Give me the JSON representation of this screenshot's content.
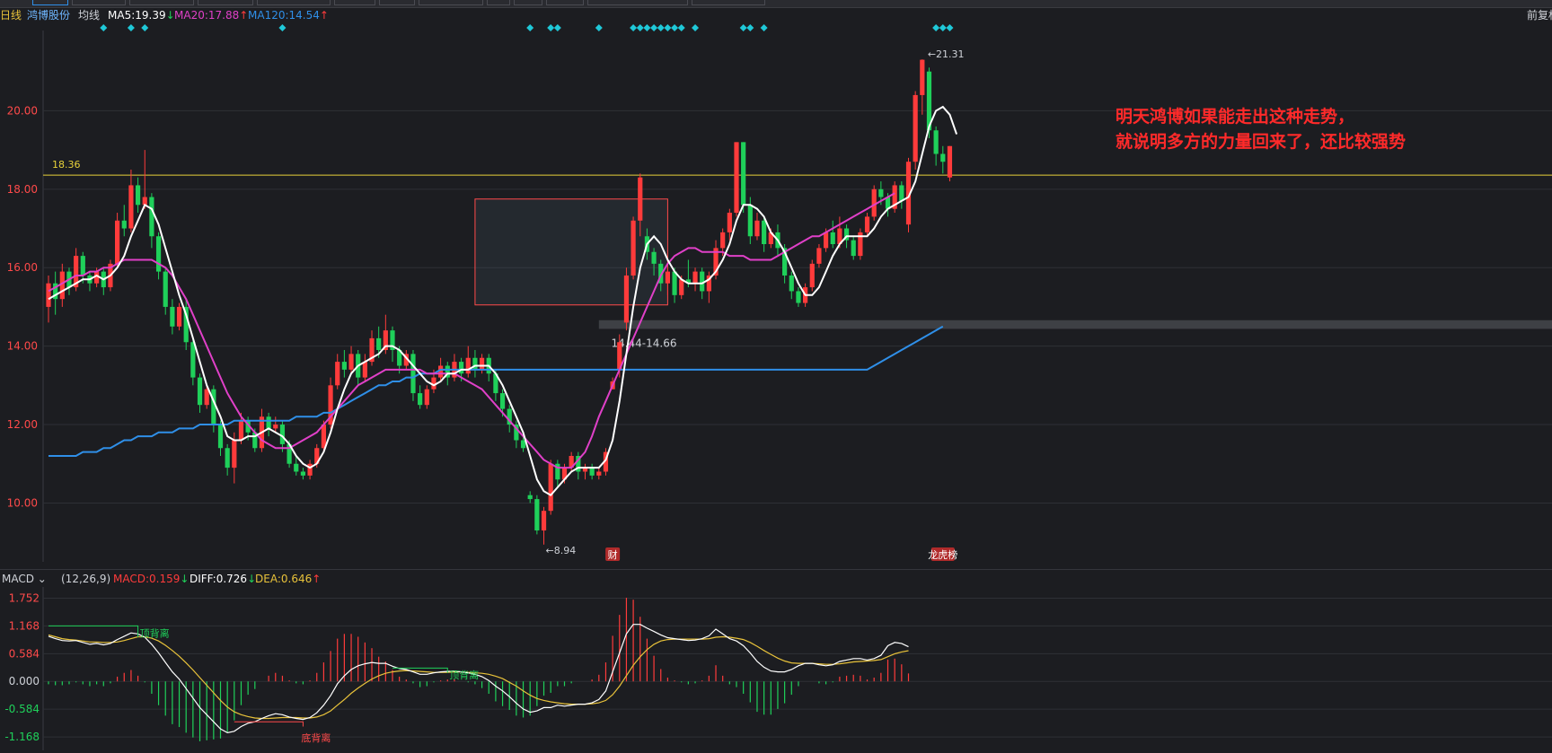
{
  "header": {
    "period": "日线",
    "stock_name": "鸿博股份",
    "avg_line": "均线",
    "ma5": "MA5:19.39",
    "ma20": "MA20:17.88",
    "ma120": "MA120:14.54",
    "ma5_arrow": "↓",
    "ma20_arrow": "↑",
    "ma120_arrow": "↑",
    "right_label": "前复权"
  },
  "colors": {
    "up": "#ff3b3b",
    "down": "#1fd05a",
    "ma5": "#ffffff",
    "ma20": "#e040c8",
    "ma120": "#2f8fe8",
    "ref_line": "#e8d23a",
    "dea": "#e8c23a",
    "diff": "#ffffff",
    "marker": "#1fc8d8"
  },
  "annotations": {
    "line1": "明天鸿博如果能走出这种走势，",
    "line2": "就说明多方的力量回来了，还比较强势",
    "ref_price": "18.36",
    "high_label": "←21.31",
    "low_label": "←8.94",
    "range_label": "14.44-14.66",
    "badge_fin": "财",
    "badge_list": "龙虎榜",
    "top_div": "顶背离",
    "bottom_div": "底背离"
  },
  "macd": {
    "name": "MACD",
    "params": "(12,26,9)",
    "macd_value": "MACD:0.159",
    "macd_arrow": "↓",
    "diff_value": "DIFF:0.726",
    "diff_arrow": "↓",
    "dea_value": "DEA:0.646",
    "dea_arrow": "↑"
  },
  "chart_data": {
    "type": "candlestick",
    "price_axis": {
      "min": 8.5,
      "max": 22.0,
      "ticks": [
        "10.00",
        "12.00",
        "14.00",
        "16.00",
        "18.00",
        "20.00"
      ]
    },
    "macd_axis": {
      "min": -1.45,
      "max": 1.95,
      "ticks": [
        "1.752",
        "1.168",
        "0.584",
        "0.000",
        "-0.584",
        "-1.168"
      ]
    },
    "reference_line": 18.36,
    "box": {
      "from": 62,
      "to": 90,
      "low": 15.05,
      "high": 17.75
    },
    "band": {
      "low": 14.44,
      "high": 14.66
    },
    "candles": [
      [
        15.0,
        15.6,
        15.8,
        14.6
      ],
      [
        15.6,
        15.2,
        15.9,
        14.8
      ],
      [
        15.2,
        15.9,
        16.1,
        15.0
      ],
      [
        15.9,
        15.5,
        16.0,
        15.3
      ],
      [
        15.5,
        16.3,
        16.5,
        15.4
      ],
      [
        16.3,
        15.8,
        16.4,
        15.6
      ],
      [
        15.8,
        15.6,
        15.9,
        15.4
      ],
      [
        15.6,
        15.9,
        16.0,
        15.5
      ],
      [
        15.9,
        15.5,
        16.0,
        15.3
      ],
      [
        15.5,
        16.1,
        16.2,
        15.4
      ],
      [
        16.1,
        17.2,
        17.4,
        16.0
      ],
      [
        17.2,
        17.0,
        17.6,
        16.8
      ],
      [
        17.0,
        18.1,
        18.5,
        16.9
      ],
      [
        18.1,
        17.6,
        18.3,
        17.4
      ],
      [
        17.6,
        17.8,
        19.0,
        17.5
      ],
      [
        17.8,
        16.8,
        17.9,
        16.5
      ],
      [
        16.8,
        15.9,
        16.9,
        15.7
      ],
      [
        15.9,
        15.0,
        16.0,
        14.8
      ],
      [
        15.0,
        14.5,
        15.2,
        14.3
      ],
      [
        14.5,
        15.0,
        15.1,
        14.4
      ],
      [
        15.0,
        14.1,
        15.2,
        13.9
      ],
      [
        14.1,
        13.2,
        14.2,
        13.0
      ],
      [
        13.2,
        12.5,
        13.3,
        12.3
      ],
      [
        12.5,
        12.9,
        13.0,
        12.4
      ],
      [
        12.9,
        12.0,
        13.0,
        11.8
      ],
      [
        12.0,
        11.4,
        12.1,
        11.2
      ],
      [
        11.4,
        10.9,
        11.5,
        10.7
      ],
      [
        10.9,
        11.6,
        11.8,
        10.5
      ],
      [
        11.6,
        12.1,
        12.3,
        11.5
      ],
      [
        12.1,
        11.8,
        12.2,
        11.6
      ],
      [
        11.8,
        11.4,
        11.9,
        11.3
      ],
      [
        11.4,
        12.2,
        12.4,
        11.3
      ],
      [
        12.2,
        11.9,
        12.3,
        11.7
      ],
      [
        11.9,
        12.0,
        12.2,
        11.8
      ],
      [
        12.0,
        11.5,
        12.1,
        11.3
      ],
      [
        11.5,
        11.0,
        11.6,
        10.9
      ],
      [
        11.0,
        10.8,
        11.2,
        10.7
      ],
      [
        10.8,
        10.7,
        10.9,
        10.6
      ],
      [
        10.7,
        11.0,
        11.1,
        10.6
      ],
      [
        11.0,
        11.4,
        11.5,
        10.9
      ],
      [
        11.4,
        12.0,
        12.1,
        11.3
      ],
      [
        12.0,
        13.0,
        13.2,
        11.9
      ],
      [
        13.0,
        13.6,
        13.8,
        12.9
      ],
      [
        13.6,
        13.4,
        13.9,
        13.2
      ],
      [
        13.4,
        13.8,
        14.0,
        13.3
      ],
      [
        13.8,
        13.2,
        13.9,
        13.0
      ],
      [
        13.2,
        13.6,
        13.8,
        13.1
      ],
      [
        13.6,
        14.2,
        14.4,
        13.5
      ],
      [
        14.2,
        13.9,
        14.5,
        13.7
      ],
      [
        13.9,
        14.4,
        14.8,
        13.8
      ],
      [
        14.4,
        13.9,
        14.5,
        13.6
      ],
      [
        13.9,
        13.5,
        14.0,
        13.3
      ],
      [
        13.5,
        13.8,
        13.9,
        13.4
      ],
      [
        13.8,
        12.8,
        13.9,
        12.6
      ],
      [
        12.8,
        12.5,
        13.0,
        12.4
      ],
      [
        12.5,
        12.9,
        13.0,
        12.4
      ],
      [
        12.9,
        13.2,
        13.4,
        12.8
      ],
      [
        13.2,
        13.5,
        13.7,
        13.1
      ],
      [
        13.5,
        13.2,
        13.6,
        13.0
      ],
      [
        13.2,
        13.6,
        13.8,
        13.1
      ],
      [
        13.6,
        13.3,
        13.7,
        13.1
      ],
      [
        13.3,
        13.7,
        14.0,
        13.2
      ],
      [
        13.7,
        13.4,
        13.9,
        13.2
      ],
      [
        13.4,
        13.7,
        13.8,
        13.3
      ],
      [
        13.7,
        13.3,
        13.8,
        13.1
      ],
      [
        13.3,
        12.8,
        13.4,
        12.6
      ],
      [
        12.8,
        12.4,
        12.9,
        12.2
      ],
      [
        12.4,
        12.0,
        12.5,
        11.8
      ],
      [
        12.0,
        11.6,
        12.1,
        11.4
      ],
      [
        11.6,
        11.4,
        11.7,
        11.3
      ],
      [
        10.2,
        10.1,
        10.3,
        10.0
      ],
      [
        10.1,
        9.3,
        10.2,
        9.2
      ],
      [
        9.3,
        9.8,
        9.9,
        8.94
      ],
      [
        9.8,
        11.0,
        11.1,
        9.7
      ],
      [
        11.0,
        10.6,
        11.1,
        10.4
      ],
      [
        10.6,
        10.9,
        11.0,
        10.5
      ],
      [
        10.9,
        11.2,
        11.3,
        10.8
      ],
      [
        11.2,
        10.8,
        11.3,
        10.6
      ],
      [
        10.8,
        10.9,
        11.0,
        10.6
      ],
      [
        10.9,
        10.7,
        11.0,
        10.6
      ],
      [
        10.7,
        10.8,
        10.9,
        10.6
      ],
      [
        10.8,
        11.3,
        11.4,
        10.7
      ],
      [
        12.9,
        13.1,
        13.2,
        12.9
      ],
      [
        13.4,
        14.1,
        14.3,
        13.2
      ],
      [
        14.6,
        15.8,
        16.0,
        14.4
      ],
      [
        15.8,
        17.2,
        17.3,
        15.7
      ],
      [
        17.2,
        18.3,
        18.4,
        16.8
      ],
      [
        16.8,
        16.4,
        17.0,
        16.2
      ],
      [
        16.4,
        16.1,
        16.5,
        15.8
      ],
      [
        16.1,
        15.6,
        16.2,
        15.4
      ],
      [
        15.6,
        15.9,
        16.0,
        15.3
      ],
      [
        15.9,
        15.3,
        16.0,
        15.1
      ],
      [
        15.3,
        15.7,
        15.8,
        15.2
      ],
      [
        15.7,
        15.6,
        16.2,
        15.5
      ],
      [
        15.6,
        15.9,
        16.0,
        15.4
      ],
      [
        15.9,
        15.4,
        16.0,
        15.2
      ],
      [
        15.4,
        15.8,
        15.9,
        15.1
      ],
      [
        15.8,
        16.5,
        16.7,
        15.7
      ],
      [
        16.5,
        16.9,
        17.0,
        16.3
      ],
      [
        16.9,
        17.4,
        17.5,
        16.7
      ],
      [
        17.4,
        19.2,
        19.2,
        17.3
      ],
      [
        19.2,
        17.6,
        19.2,
        17.4
      ],
      [
        17.6,
        16.8,
        17.8,
        16.6
      ],
      [
        16.8,
        17.2,
        17.4,
        16.7
      ],
      [
        17.2,
        16.6,
        17.3,
        16.4
      ],
      [
        16.6,
        16.9,
        17.0,
        16.5
      ],
      [
        16.9,
        16.5,
        17.1,
        16.3
      ],
      [
        16.5,
        15.8,
        16.6,
        15.6
      ],
      [
        15.8,
        15.4,
        15.9,
        15.2
      ],
      [
        15.4,
        15.1,
        15.5,
        15.0
      ],
      [
        15.1,
        15.5,
        15.6,
        15.0
      ],
      [
        15.5,
        16.1,
        16.2,
        15.4
      ],
      [
        16.1,
        16.5,
        16.6,
        16.0
      ],
      [
        16.5,
        16.9,
        17.0,
        16.4
      ],
      [
        16.9,
        16.6,
        17.2,
        16.5
      ],
      [
        16.6,
        17.0,
        17.3,
        16.5
      ],
      [
        17.0,
        16.7,
        17.1,
        16.5
      ],
      [
        16.7,
        16.3,
        16.8,
        16.2
      ],
      [
        16.3,
        16.9,
        17.0,
        16.2
      ],
      [
        16.9,
        17.3,
        17.4,
        16.8
      ],
      [
        17.3,
        18.0,
        18.1,
        17.2
      ],
      [
        18.0,
        17.8,
        18.2,
        17.6
      ],
      [
        17.8,
        17.5,
        17.9,
        17.3
      ],
      [
        17.5,
        18.1,
        18.2,
        17.4
      ],
      [
        18.1,
        17.7,
        18.2,
        17.5
      ],
      [
        17.1,
        18.7,
        18.8,
        16.9
      ],
      [
        18.7,
        20.4,
        20.5,
        18.5
      ],
      [
        20.4,
        21.3,
        21.31,
        19.9
      ],
      [
        21.0,
        19.5,
        21.1,
        19.3
      ],
      [
        19.5,
        18.9,
        19.6,
        18.6
      ],
      [
        18.9,
        18.7,
        19.1,
        18.4
      ],
      [
        18.3,
        19.1,
        19.1,
        18.2
      ]
    ],
    "ma5": [
      15.2,
      15.3,
      15.4,
      15.5,
      15.6,
      15.7,
      15.7,
      15.8,
      15.7,
      15.8,
      16.0,
      16.3,
      16.8,
      17.2,
      17.6,
      17.5,
      17.1,
      16.5,
      15.9,
      15.3,
      14.8,
      14.2,
      13.6,
      13.0,
      12.6,
      12.2,
      11.7,
      11.6,
      11.6,
      11.7,
      11.7,
      11.8,
      11.9,
      11.8,
      11.7,
      11.5,
      11.2,
      11.0,
      10.9,
      11.0,
      11.3,
      11.8,
      12.4,
      12.9,
      13.3,
      13.5,
      13.6,
      13.7,
      13.8,
      14.0,
      14.0,
      13.9,
      13.7,
      13.5,
      13.3,
      13.1,
      13.0,
      13.1,
      13.3,
      13.3,
      13.4,
      13.4,
      13.5,
      13.5,
      13.5,
      13.3,
      13.0,
      12.6,
      12.2,
      11.8,
      11.2,
      10.6,
      10.3,
      10.2,
      10.4,
      10.6,
      10.8,
      10.9,
      10.9,
      10.9,
      10.9,
      11.1,
      11.6,
      12.6,
      13.8,
      15.0,
      16.0,
      16.6,
      16.8,
      16.6,
      16.2,
      15.9,
      15.7,
      15.6,
      15.6,
      15.6,
      15.7,
      15.9,
      16.2,
      16.6,
      17.2,
      17.6,
      17.6,
      17.5,
      17.3,
      16.9,
      16.7,
      16.4,
      16.0,
      15.6,
      15.3,
      15.3,
      15.5,
      15.9,
      16.3,
      16.6,
      16.8,
      16.8,
      16.8,
      16.8,
      17.0,
      17.3,
      17.5,
      17.6,
      17.7,
      17.8,
      18.2,
      18.9,
      19.6,
      20.0,
      20.1,
      19.9,
      19.4
    ],
    "ma20": [
      15.4,
      15.5,
      15.6,
      15.7,
      15.8,
      15.8,
      15.9,
      15.9,
      16.0,
      16.0,
      16.1,
      16.2,
      16.2,
      16.2,
      16.2,
      16.2,
      16.1,
      16.0,
      15.8,
      15.5,
      15.2,
      14.8,
      14.4,
      14.0,
      13.6,
      13.2,
      12.8,
      12.5,
      12.2,
      12.0,
      11.8,
      11.6,
      11.5,
      11.4,
      11.4,
      11.4,
      11.5,
      11.6,
      11.7,
      11.8,
      12.0,
      12.2,
      12.4,
      12.6,
      12.8,
      13.0,
      13.1,
      13.2,
      13.3,
      13.4,
      13.4,
      13.4,
      13.4,
      13.4,
      13.4,
      13.3,
      13.3,
      13.3,
      13.3,
      13.3,
      13.2,
      13.1,
      13.0,
      12.9,
      12.7,
      12.5,
      12.3,
      12.1,
      11.9,
      11.7,
      11.5,
      11.3,
      11.1,
      11.0,
      10.9,
      10.9,
      10.9,
      11.1,
      11.3,
      11.7,
      12.2,
      12.6,
      13.0,
      13.4,
      13.8,
      14.2,
      14.6,
      15.0,
      15.4,
      15.8,
      16.1,
      16.3,
      16.4,
      16.5,
      16.5,
      16.4,
      16.4,
      16.4,
      16.4,
      16.3,
      16.3,
      16.3,
      16.2,
      16.2,
      16.2,
      16.2,
      16.3,
      16.4,
      16.5,
      16.6,
      16.7,
      16.8,
      16.8,
      16.9,
      17.0,
      17.1,
      17.2,
      17.3,
      17.4,
      17.5,
      17.6,
      17.7,
      17.8,
      17.9
    ],
    "ma120": [
      11.2,
      11.2,
      11.2,
      11.2,
      11.2,
      11.3,
      11.3,
      11.3,
      11.4,
      11.4,
      11.5,
      11.6,
      11.6,
      11.7,
      11.7,
      11.7,
      11.8,
      11.8,
      11.8,
      11.9,
      11.9,
      11.9,
      12.0,
      12.0,
      12.0,
      12.0,
      12.0,
      12.1,
      12.1,
      12.1,
      12.1,
      12.1,
      12.1,
      12.1,
      12.1,
      12.1,
      12.2,
      12.2,
      12.2,
      12.2,
      12.3,
      12.3,
      12.4,
      12.5,
      12.6,
      12.7,
      12.8,
      12.9,
      13.0,
      13.0,
      13.1,
      13.1,
      13.2,
      13.2,
      13.3,
      13.3,
      13.3,
      13.4,
      13.4,
      13.4,
      13.4,
      13.4,
      13.4,
      13.4,
      13.4,
      13.4,
      13.4,
      13.4,
      13.4,
      13.4,
      13.4,
      13.4,
      13.4,
      13.4,
      13.4,
      13.4,
      13.4,
      13.4,
      13.4,
      13.4,
      13.4,
      13.4,
      13.4,
      13.4,
      13.4,
      13.4,
      13.4,
      13.4,
      13.4,
      13.4,
      13.4,
      13.4,
      13.4,
      13.4,
      13.4,
      13.4,
      13.4,
      13.4,
      13.4,
      13.4,
      13.4,
      13.4,
      13.4,
      13.4,
      13.4,
      13.4,
      13.4,
      13.4,
      13.4,
      13.4,
      13.4,
      13.4,
      13.4,
      13.4,
      13.4,
      13.4,
      13.4,
      13.4,
      13.4,
      13.4,
      13.5,
      13.6,
      13.7,
      13.8,
      13.9,
      14.0,
      14.1,
      14.2,
      14.3,
      14.4,
      14.5
    ],
    "diff": [
      0.95,
      0.9,
      0.86,
      0.85,
      0.86,
      0.82,
      0.78,
      0.8,
      0.77,
      0.8,
      0.88,
      0.95,
      1.02,
      1.0,
      0.93,
      0.78,
      0.6,
      0.4,
      0.2,
      0.05,
      -0.15,
      -0.35,
      -0.55,
      -0.7,
      -0.85,
      -1.0,
      -1.08,
      -1.05,
      -0.95,
      -0.88,
      -0.85,
      -0.78,
      -0.72,
      -0.68,
      -0.7,
      -0.75,
      -0.78,
      -0.8,
      -0.76,
      -0.66,
      -0.5,
      -0.3,
      -0.05,
      0.12,
      0.25,
      0.33,
      0.37,
      0.4,
      0.38,
      0.38,
      0.32,
      0.27,
      0.25,
      0.2,
      0.15,
      0.15,
      0.18,
      0.2,
      0.21,
      0.22,
      0.2,
      0.18,
      0.15,
      0.1,
      0.02,
      -0.1,
      -0.2,
      -0.32,
      -0.46,
      -0.58,
      -0.65,
      -0.62,
      -0.55,
      -0.55,
      -0.5,
      -0.52,
      -0.5,
      -0.48,
      -0.48,
      -0.45,
      -0.38,
      -0.2,
      0.2,
      0.6,
      1.0,
      1.2,
      1.2,
      1.12,
      1.05,
      0.98,
      0.92,
      0.9,
      0.88,
      0.86,
      0.87,
      0.9,
      0.96,
      1.1,
      1.0,
      0.9,
      0.85,
      0.75,
      0.6,
      0.42,
      0.3,
      0.22,
      0.2,
      0.2,
      0.25,
      0.33,
      0.38,
      0.38,
      0.35,
      0.33,
      0.35,
      0.42,
      0.45,
      0.48,
      0.48,
      0.45,
      0.48,
      0.55,
      0.75,
      0.82,
      0.8,
      0.73
    ],
    "dea": [
      0.98,
      0.94,
      0.9,
      0.88,
      0.87,
      0.85,
      0.83,
      0.83,
      0.82,
      0.82,
      0.83,
      0.86,
      0.9,
      0.94,
      0.94,
      0.91,
      0.85,
      0.76,
      0.65,
      0.53,
      0.39,
      0.24,
      0.08,
      -0.08,
      -0.24,
      -0.4,
      -0.54,
      -0.64,
      -0.7,
      -0.74,
      -0.77,
      -0.78,
      -0.78,
      -0.77,
      -0.76,
      -0.76,
      -0.76,
      -0.77,
      -0.77,
      -0.75,
      -0.7,
      -0.62,
      -0.5,
      -0.38,
      -0.25,
      -0.14,
      -0.04,
      0.05,
      0.12,
      0.17,
      0.2,
      0.22,
      0.23,
      0.22,
      0.21,
      0.2,
      0.19,
      0.19,
      0.19,
      0.2,
      0.2,
      0.19,
      0.18,
      0.17,
      0.15,
      0.11,
      0.06,
      -0.02,
      -0.1,
      -0.2,
      -0.29,
      -0.36,
      -0.4,
      -0.43,
      -0.45,
      -0.47,
      -0.48,
      -0.48,
      -0.48,
      -0.47,
      -0.45,
      -0.4,
      -0.28,
      -0.1,
      0.12,
      0.34,
      0.52,
      0.67,
      0.78,
      0.85,
      0.88,
      0.89,
      0.89,
      0.89,
      0.89,
      0.89,
      0.9,
      0.93,
      0.94,
      0.93,
      0.91,
      0.88,
      0.82,
      0.74,
      0.65,
      0.57,
      0.49,
      0.43,
      0.39,
      0.38,
      0.38,
      0.38,
      0.37,
      0.36,
      0.36,
      0.37,
      0.39,
      0.41,
      0.42,
      0.43,
      0.44,
      0.46,
      0.52,
      0.58,
      0.62,
      0.646
    ]
  }
}
